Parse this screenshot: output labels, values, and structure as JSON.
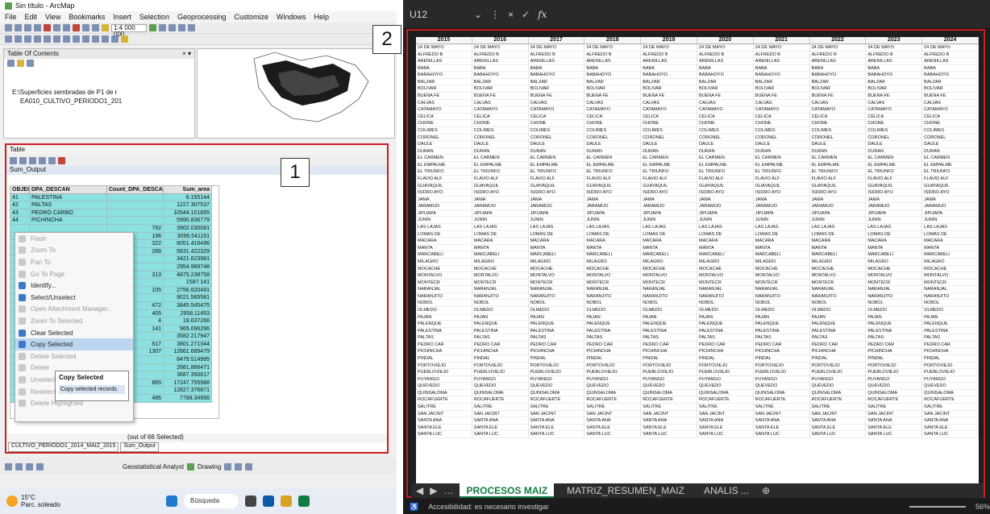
{
  "arcmap": {
    "title": "Sin título - ArcMap",
    "menu": [
      "File",
      "Edit",
      "View",
      "Bookmarks",
      "Insert",
      "Selection",
      "Geoprocessing",
      "Customize",
      "Windows",
      "Help"
    ],
    "scale": "1:4 000 000",
    "toc_title": "Table Of Contents",
    "toc_layers": [
      "E:\\Superficies sembradas de P1 de r",
      "EA010_CULTIVO_PERIODO1_201"
    ],
    "table": {
      "title": "Table",
      "name": "Sum_Output",
      "columns": [
        "OBJECTID *",
        "DPA_DESCAN",
        "Count_DPA_DESCAN",
        "Sum_area"
      ],
      "rows": [
        [
          "41",
          "PALESTINA",
          "",
          "6.155144"
        ],
        [
          "42",
          "PALTAS",
          "61",
          "1227.307537"
        ],
        [
          "43",
          "PEDRO CARBO",
          "1036",
          "10544.151855"
        ],
        [
          "44",
          "PICHINCHA",
          "753",
          "5990.836779"
        ],
        [
          "",
          "",
          "",
          "3902.030081"
        ],
        [
          "",
          "",
          "",
          "3096.541191"
        ],
        [
          "",
          "",
          "",
          "6051.416496"
        ],
        [
          "",
          "",
          "",
          "5631.422329"
        ],
        [
          "",
          "",
          "",
          "3421.623981"
        ],
        [
          "",
          "",
          "",
          "2954.989748"
        ],
        [
          "",
          "",
          "",
          "4875.238758"
        ],
        [
          "",
          "",
          "",
          "1587.141"
        ],
        [
          "",
          "",
          "",
          "2756.620491"
        ],
        [
          "",
          "",
          "",
          "9021.565581"
        ],
        [
          "",
          "",
          "",
          "3845.545475"
        ],
        [
          "",
          "",
          "",
          "2958.11453"
        ],
        [
          "",
          "",
          "",
          "19.637266"
        ],
        [
          "",
          "",
          "",
          "965.696296"
        ],
        [
          "",
          "",
          "",
          "3582.217947"
        ],
        [
          "",
          "",
          "",
          "3801.271344"
        ],
        [
          "",
          "",
          "",
          "12661.689479"
        ],
        [
          "",
          "",
          "",
          "8479.514995"
        ],
        [
          "",
          "",
          "",
          "2681.866471"
        ],
        [
          "",
          "",
          "",
          "3687.350617"
        ],
        [
          "",
          "",
          "",
          "17247.755988"
        ],
        [
          "",
          "",
          "",
          "12827.376871"
        ],
        [
          "",
          "",
          "",
          "7788.34656"
        ]
      ],
      "counts": [
        "",
        "",
        "",
        "",
        "792",
        "196",
        "322",
        "268",
        "",
        "",
        "313",
        "",
        "105",
        "",
        "472",
        "405",
        "4",
        "141",
        "",
        "617",
        "1307",
        "",
        "",
        "",
        "865",
        "",
        "486"
      ],
      "status": "(out of 66 Selected)",
      "tabs": [
        "CULTIVO_PERIODO1_2014_MAIZ_2015",
        "Sum_Output"
      ]
    },
    "context_menu": [
      {
        "label": "Flash",
        "enabled": false
      },
      {
        "label": "Zoom To",
        "enabled": false
      },
      {
        "label": "Pan To",
        "enabled": false
      },
      {
        "label": "Go To Page",
        "enabled": false
      },
      {
        "label": "Identify...",
        "enabled": true
      },
      {
        "label": "Select/Unselect",
        "enabled": true
      },
      {
        "label": "Open Attachment Manager...",
        "enabled": false
      },
      {
        "label": "Zoom To Selected",
        "enabled": false
      },
      {
        "label": "Clear Selected",
        "enabled": true
      },
      {
        "label": "Copy Selected",
        "enabled": true,
        "selected": true
      },
      {
        "label": "Delete Selected",
        "enabled": false
      },
      {
        "label": "Delete",
        "enabled": false
      },
      {
        "label": "Unselect Highlighted",
        "enabled": false
      },
      {
        "label": "Reselect Highlighted",
        "enabled": false
      },
      {
        "label": "Delete Highlighted",
        "enabled": false
      }
    ],
    "tooltip": {
      "title": "Copy Selected",
      "desc": "Copy selected records."
    },
    "bottom_toolbar": {
      "geostat": "Geostatistical Analyst",
      "drawing": "Drawing"
    }
  },
  "taskbar": {
    "temp": "15°C",
    "weather": "Parc. soleado",
    "search": "Búsqueda"
  },
  "badges": [
    "1",
    "2"
  ],
  "excel": {
    "namebox": "U12",
    "fx": "fx",
    "years": [
      "2015",
      "2016",
      "2017",
      "2018",
      "2019",
      "2020",
      "2021",
      "2022",
      "2023",
      "2024"
    ],
    "rows": [
      [
        "24 DE MAYO",
        "ALFREDO B",
        "ARENILLAS",
        "BABA",
        "BABAHOYO",
        "BALZAR",
        "BOLIVAR",
        "BUENA FE",
        "CALVAS",
        "CATAMAYO",
        "CELICA",
        "CHONE",
        "COLIMES",
        "CORONEL",
        "DAULE",
        "DURAN",
        "EL CARMEN",
        "EL EMPALME",
        "EL TRIUNFO",
        "FLAVIO ALF",
        "GUAYAQUIL",
        "ISIDRO AYO",
        "JAMA",
        "JARAMIJO",
        "JIPIJAPA",
        "JUNIN",
        "LAS LAJAS",
        "LOMAS DE",
        "MACARA",
        "MANTA",
        "MARCABELI",
        "MILAGRO",
        "MOCACHE",
        "MONTALVO",
        "MONTECR",
        "NARANJAL",
        "NARANJITO",
        "NOBOL",
        "OLMEDO",
        "PAJAN",
        "PALENQUE",
        "PALESTINA",
        "PALTAS",
        "PEDRO CAR",
        "PICHINCHA",
        "PINDAL",
        "PORTOVIEJO",
        "PUEBLOVIEJO",
        "PUYANGO",
        "QUEVEDO",
        "QUINSALOMA",
        "ROCAFUERTE",
        "SALITRE",
        "SAN JACINT",
        "SANTA ANA",
        "SANTA ELE",
        "SANTA LUC"
      ],
      [
        "24 DE MAYO",
        "ALFREDO B",
        "ARENILLAS",
        "BABA",
        "BABAHOYO",
        "BALZAR",
        "BOLIVAR",
        "BUENA FE",
        "CALVAS",
        "CATAMAYO",
        "CELICA",
        "CHONE",
        "COLIMES",
        "CORONEL",
        "DAULE",
        "DURAN",
        "EL CARMEN",
        "EL EMPALME",
        "EL TRIUNFO",
        "FLAVIO ALF",
        "GUAYAQUIL",
        "ISIDRO AYO",
        "JAMA",
        "JARAMIJO",
        "JIPIJAPA",
        "JUNIN",
        "LAS LAJAS",
        "LOMAS DE",
        "MACARA",
        "MANTA",
        "MARCABELI",
        "MILAGRO",
        "MOCACHE",
        "MONTALVO",
        "MONTECR",
        "NARANJAL",
        "NARANJITO",
        "NOBOL",
        "OLMEDO",
        "PAJAN",
        "PALENQUE",
        "PALESTINA",
        "PALTAS",
        "PEDRO CAR",
        "PICHINCHA",
        "PINDAL",
        "PORTOVIEJO",
        "PUEBLOVIEJO",
        "PUYANGO",
        "QUEVEDO",
        "QUINSALOMA",
        "ROCAFUERTE",
        "SALITRE",
        "SAN JACINT",
        "SANTA ANA",
        "SANTA ELE",
        "SANTA LUC"
      ]
    ],
    "tabs": [
      "PROCESOS MAIZ",
      "MATRIZ_RESUMEN_MAIZ",
      "ANALIS ..."
    ],
    "status": "Accesibilidad: es necesario investigar",
    "zoom": "56%"
  }
}
